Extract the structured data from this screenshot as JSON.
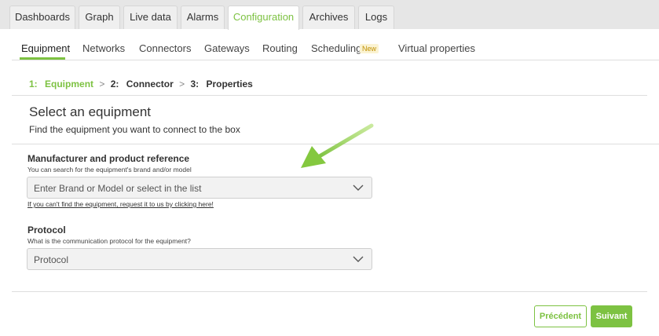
{
  "tabs": [
    {
      "label": "Dashboards"
    },
    {
      "label": "Graph"
    },
    {
      "label": "Live data"
    },
    {
      "label": "Alarms"
    },
    {
      "label": "Configuration",
      "active": true
    },
    {
      "label": "Archives"
    },
    {
      "label": "Logs"
    }
  ],
  "subnav": {
    "items": [
      "Equipment",
      "Networks",
      "Connectors",
      "Gateways",
      "Routing",
      "Scheduling",
      "Virtual properties"
    ],
    "new_badge": "New"
  },
  "stepper": {
    "step1_num": "1:",
    "step1_label": "Equipment",
    "step2_num": "2:",
    "step2_label": "Connector",
    "step3_num": "3:",
    "step3_label": "Properties",
    "separator": ">"
  },
  "page": {
    "title": "Select an equipment",
    "subtitle": "Find the equipment you want to connect to the box"
  },
  "manufacturer": {
    "label": "Manufacturer and product reference",
    "hint": "You can search for the equipment's brand and/or model",
    "placeholder": "Enter Brand or Model or select in the list",
    "link": "If you can't find the equipment, request it to us by clicking here!"
  },
  "protocol": {
    "label": "Protocol",
    "hint": "What is the communication protocol for the equipment?",
    "placeholder": "Protocol"
  },
  "buttons": {
    "previous": "Précédent",
    "next": "Suivant"
  },
  "colors": {
    "accent": "#7dc242",
    "annotation_arrow": "#8ccf3f"
  },
  "icons": {
    "select_chevron": "chevron-down-icon",
    "annotation": "arrow-annotation-icon"
  }
}
